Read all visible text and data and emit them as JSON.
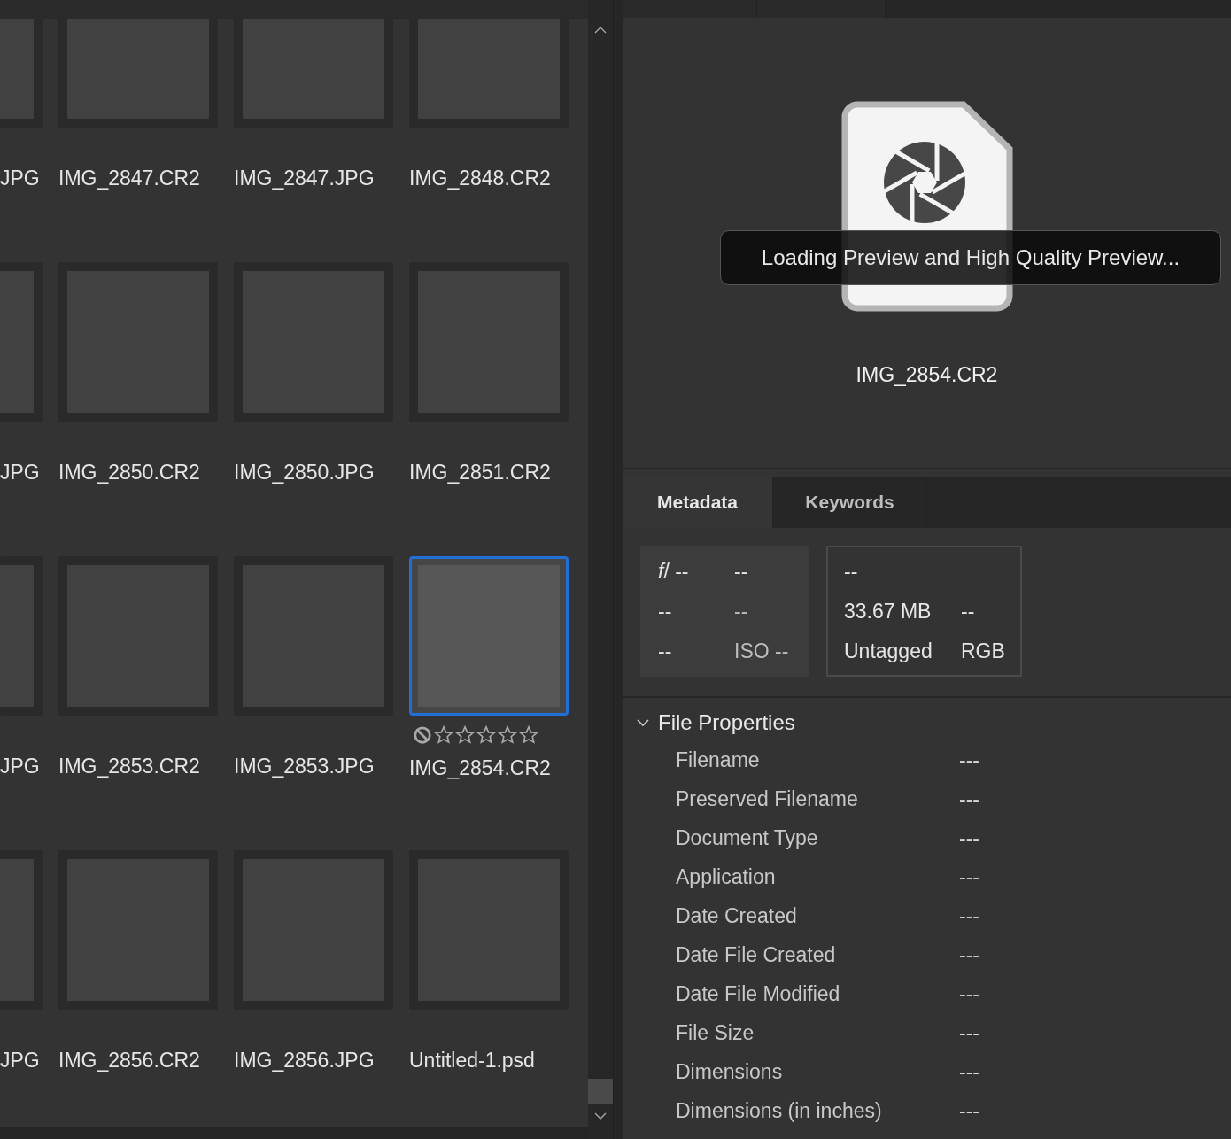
{
  "grid": {
    "rows": [
      {
        "items": [
          {
            "label": "JPG",
            "selected": false
          },
          {
            "label": "IMG_2847.CR2",
            "selected": false
          },
          {
            "label": "IMG_2847.JPG",
            "selected": false
          },
          {
            "label": "IMG_2848.CR2",
            "selected": false
          }
        ]
      },
      {
        "items": [
          {
            "label": "JPG",
            "selected": false
          },
          {
            "label": "IMG_2850.CR2",
            "selected": false
          },
          {
            "label": "IMG_2850.JPG",
            "selected": false
          },
          {
            "label": "IMG_2851.CR2",
            "selected": false
          }
        ]
      },
      {
        "items": [
          {
            "label": "JPG",
            "selected": false
          },
          {
            "label": "IMG_2853.CR2",
            "selected": false
          },
          {
            "label": "IMG_2853.JPG",
            "selected": false
          },
          {
            "label": "IMG_2854.CR2",
            "selected": true,
            "stars": 0
          }
        ]
      },
      {
        "items": [
          {
            "label": "JPG",
            "selected": false
          },
          {
            "label": "IMG_2856.CR2",
            "selected": false
          },
          {
            "label": "IMG_2856.JPG",
            "selected": false
          },
          {
            "label": "Untitled-1.psd",
            "selected": false
          }
        ]
      }
    ]
  },
  "preview": {
    "status": "Loading Preview and High Quality Preview...",
    "filename": "IMG_2854.CR2"
  },
  "tabs": [
    {
      "label": "Metadata",
      "selected": true
    },
    {
      "label": "Keywords",
      "selected": false
    }
  ],
  "camera_box": [
    "*f*/ --",
    "--",
    "--",
    "--",
    "--",
    "ISO --"
  ],
  "file_box": [
    [
      "--"
    ],
    [
      "33.67 MB",
      "--"
    ],
    [
      "Untagged",
      "RGB"
    ]
  ],
  "file_properties": {
    "title": "File Properties",
    "expanded": true,
    "rows": [
      {
        "label": "Filename",
        "value": "---"
      },
      {
        "label": "Preserved Filename",
        "value": "---"
      },
      {
        "label": "Document Type",
        "value": "---"
      },
      {
        "label": "Application",
        "value": "---"
      },
      {
        "label": "Date Created",
        "value": "---"
      },
      {
        "label": "Date File Created",
        "value": "---"
      },
      {
        "label": "Date File Modified",
        "value": "---"
      },
      {
        "label": "File Size",
        "value": "---"
      },
      {
        "label": "Dimensions",
        "value": "---"
      },
      {
        "label": "Dimensions (in inches)",
        "value": "---"
      }
    ]
  }
}
